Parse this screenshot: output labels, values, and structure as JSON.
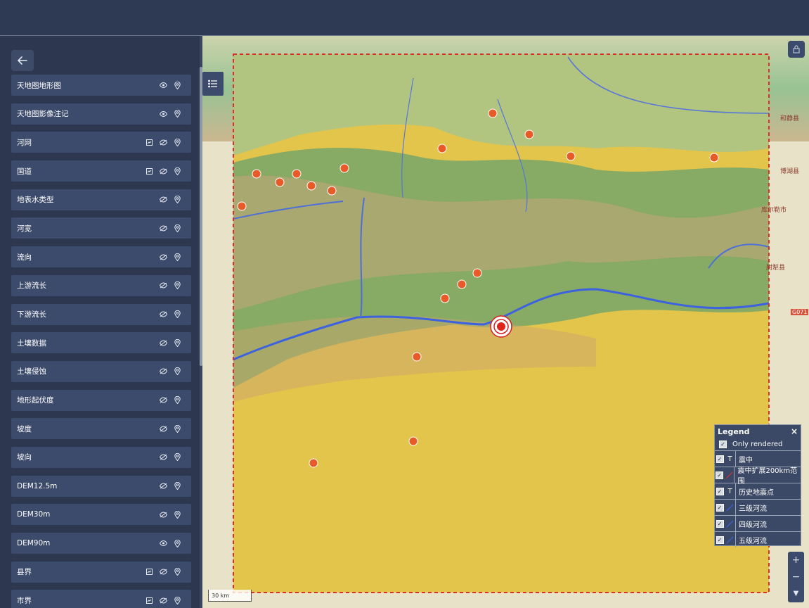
{
  "sidebar": {
    "back_icon": "arrow-left-icon",
    "layers": [
      {
        "label": "天地图地形图",
        "icons": [
          "eye-icon",
          "location-icon"
        ]
      },
      {
        "label": "天地图影像注记",
        "icons": [
          "eye-icon",
          "location-icon"
        ]
      },
      {
        "label": "河网",
        "icons": [
          "table-icon",
          "eye-off-icon",
          "location-icon"
        ]
      },
      {
        "label": "国道",
        "icons": [
          "table-icon",
          "eye-off-icon",
          "location-icon"
        ]
      },
      {
        "label": "地表水类型",
        "icons": [
          "eye-off-icon",
          "location-icon"
        ]
      },
      {
        "label": "河宽",
        "icons": [
          "eye-off-icon",
          "location-icon"
        ]
      },
      {
        "label": "流向",
        "icons": [
          "eye-off-icon",
          "location-icon"
        ]
      },
      {
        "label": "上游流长",
        "icons": [
          "eye-off-icon",
          "location-icon"
        ]
      },
      {
        "label": "下游流长",
        "icons": [
          "eye-off-icon",
          "location-icon"
        ]
      },
      {
        "label": "土壤数据",
        "icons": [
          "eye-off-icon",
          "location-icon"
        ]
      },
      {
        "label": "土壤侵蚀",
        "icons": [
          "eye-off-icon",
          "location-icon"
        ]
      },
      {
        "label": "地形起伏度",
        "icons": [
          "eye-off-icon",
          "location-icon"
        ]
      },
      {
        "label": "坡度",
        "icons": [
          "eye-off-icon",
          "location-icon"
        ]
      },
      {
        "label": "坡向",
        "icons": [
          "eye-off-icon",
          "location-icon"
        ]
      },
      {
        "label": "DEM12.5m",
        "icons": [
          "eye-off-icon",
          "location-icon"
        ]
      },
      {
        "label": "DEM30m",
        "icons": [
          "eye-off-icon",
          "location-icon"
        ]
      },
      {
        "label": "DEM90m",
        "icons": [
          "eye-icon",
          "location-icon"
        ]
      },
      {
        "label": "县界",
        "icons": [
          "table-icon",
          "eye-off-icon",
          "location-icon"
        ]
      },
      {
        "label": "市界",
        "icons": [
          "table-icon",
          "eye-off-icon",
          "location-icon"
        ]
      }
    ]
  },
  "map": {
    "labels": {
      "hejing": "和静县",
      "bohu": "博湖县",
      "korla": "库尔勒市",
      "yuli": "尉犁县",
      "road": "G071"
    },
    "scale": "30 km"
  },
  "legend": {
    "title": "Legend",
    "close": "×",
    "only_rendered": "Only rendered",
    "items": [
      {
        "label": "震中",
        "symbol": "text-T"
      },
      {
        "label": "震中扩展200km范围",
        "symbol": "red-line"
      },
      {
        "label": "历史地震点",
        "symbol": "text-T"
      },
      {
        "label": "三级河流",
        "symbol": "blue-line"
      },
      {
        "label": "四级河流",
        "symbol": "blue-line"
      },
      {
        "label": "五级河流",
        "symbol": "blue-line"
      }
    ]
  },
  "zoom": {
    "in": "+",
    "out": "−",
    "down": "▼"
  }
}
